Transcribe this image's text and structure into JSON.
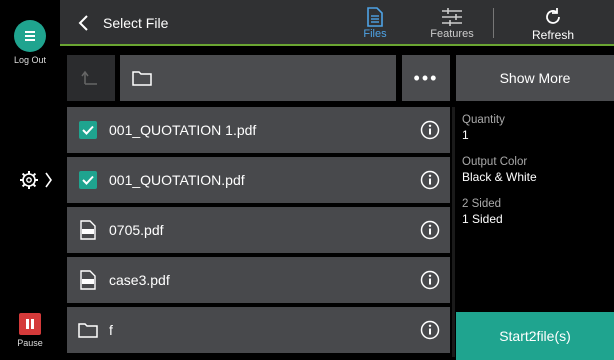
{
  "rail": {
    "logout_label": "Log Out",
    "pause_label": "Pause"
  },
  "header": {
    "title": "Select File",
    "files_label": "Files",
    "features_label": "Features",
    "refresh_label": "Refresh",
    "accent": "#6aa532"
  },
  "toolbar": {
    "more_label": "•••",
    "show_more_label": "Show More"
  },
  "files": [
    {
      "name": "001_QUOTATION 1.pdf",
      "type": "pdf",
      "checked": true
    },
    {
      "name": "001_QUOTATION.pdf",
      "type": "pdf",
      "checked": true
    },
    {
      "name": "0705.pdf",
      "type": "pdf",
      "checked": false
    },
    {
      "name": "case3.pdf",
      "type": "pdf",
      "checked": false
    },
    {
      "name": "f",
      "type": "folder",
      "checked": false
    }
  ],
  "settings": {
    "quantity_label": "Quantity",
    "quantity_value": "1",
    "color_label": "Output Color",
    "color_value": "Black & White",
    "sided_label": "2 Sided",
    "sided_value": "1 Sided"
  },
  "start_label": "Start2file(s)",
  "colors": {
    "teal": "#1fa48f",
    "pause_red": "#d43a3a",
    "files_blue": "#4ea3e6"
  }
}
